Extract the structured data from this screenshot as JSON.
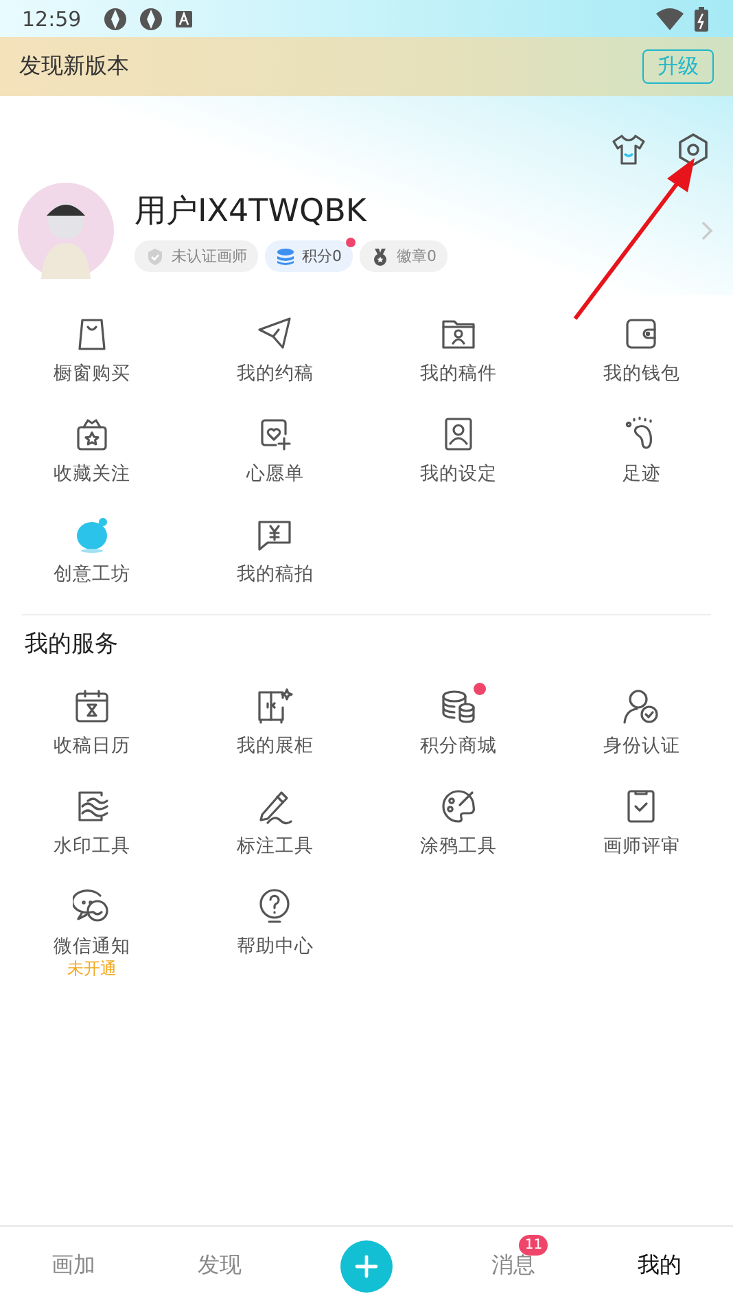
{
  "status_bar": {
    "time": "12:59"
  },
  "update_banner": {
    "text": "发现新版本",
    "button": "升级"
  },
  "profile": {
    "username": "用户IX4TWQBK",
    "tags": [
      {
        "kind": "certification",
        "label": "未认证画师",
        "has_dot": false
      },
      {
        "kind": "points",
        "label": "积分0",
        "has_dot": true
      },
      {
        "kind": "medal",
        "label": "徽章0",
        "has_dot": false
      }
    ]
  },
  "menu_items": [
    {
      "label": "橱窗购买"
    },
    {
      "label": "我的约稿"
    },
    {
      "label": "我的稿件"
    },
    {
      "label": "我的钱包"
    },
    {
      "label": "收藏关注"
    },
    {
      "label": "心愿单"
    },
    {
      "label": "我的设定"
    },
    {
      "label": "足迹"
    },
    {
      "label": "创意工坊"
    },
    {
      "label": "我的稿拍"
    }
  ],
  "services": {
    "title": "我的服务",
    "items": [
      {
        "label": "收稿日历",
        "has_dot": false
      },
      {
        "label": "我的展柜",
        "has_dot": false
      },
      {
        "label": "积分商城",
        "has_dot": true
      },
      {
        "label": "身份认证",
        "has_dot": false
      },
      {
        "label": "水印工具",
        "has_dot": false
      },
      {
        "label": "标注工具",
        "has_dot": false
      },
      {
        "label": "涂鸦工具",
        "has_dot": false
      },
      {
        "label": "画师评审",
        "has_dot": false
      },
      {
        "label": "微信通知",
        "has_dot": false,
        "note": "未开通"
      },
      {
        "label": "帮助中心",
        "has_dot": false
      }
    ]
  },
  "bottom_nav": [
    {
      "kind": "tab",
      "label": "画加",
      "selected": false
    },
    {
      "kind": "tab",
      "label": "发现",
      "selected": false
    },
    {
      "kind": "add"
    },
    {
      "kind": "tab",
      "label": "消息",
      "selected": false,
      "badge": "11"
    },
    {
      "kind": "tab",
      "label": "我的",
      "selected": true
    }
  ]
}
